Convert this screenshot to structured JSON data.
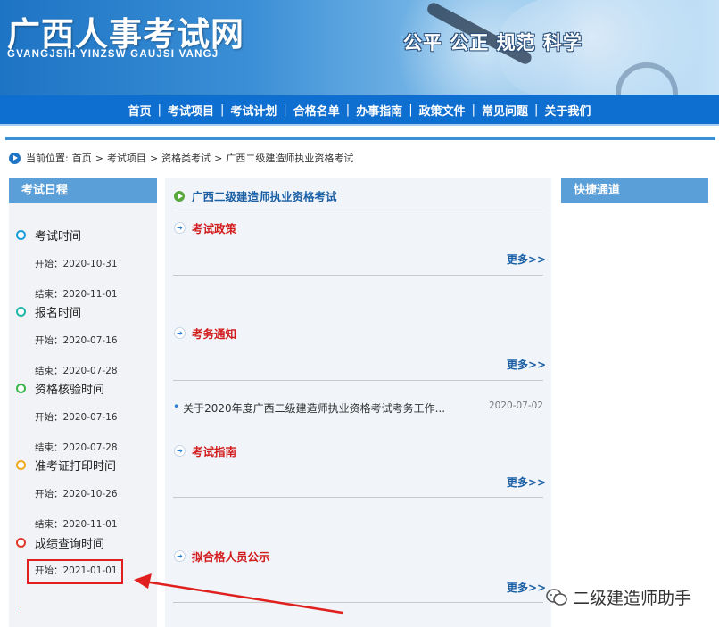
{
  "header": {
    "title": "广西人事考试网",
    "pinyin": "GVANGJSIH YINZSW GAUJSI VANGJ",
    "slogan": "公平 公正 规范 科学"
  },
  "nav": [
    "首页",
    "考试项目",
    "考试计划",
    "合格名单",
    "办事指南",
    "政策文件",
    "常见问题",
    "关于我们"
  ],
  "breadcrumb": {
    "label": "当前位置:",
    "items": [
      "首页",
      ">",
      "考试项目",
      ">",
      "资格类考试",
      ">",
      "广西二级建造师执业资格考试"
    ]
  },
  "left": {
    "heading": "考试日程",
    "items": [
      {
        "title": "考试时间",
        "start": "开始：2020-10-31",
        "end": "结束：2020-11-01",
        "color": "#1a9cd8"
      },
      {
        "title": "报名时间",
        "start": "开始：2020-07-16",
        "end": "结束：2020-07-28",
        "color": "#22b6a8"
      },
      {
        "title": "资格核验时间",
        "start": "开始：2020-07-16",
        "end": "结束：2020-07-28",
        "color": "#3cb54a"
      },
      {
        "title": "准考证打印时间",
        "start": "开始：2020-10-26",
        "end": "结束：2020-11-01",
        "color": "#f0a81e"
      },
      {
        "title": "成绩查询时间",
        "start": "开始：2021-01-01",
        "end": "",
        "color": "#e0392b"
      }
    ]
  },
  "main": {
    "heading": "广西二级建造师执业资格考试",
    "more_label": "更多>>",
    "sections": [
      {
        "title": "考试政策",
        "news": []
      },
      {
        "title": "考务通知",
        "news": [
          {
            "title": "关于2020年度广西二级建造师执业资格考试考务工作...",
            "date": "2020-07-02"
          }
        ]
      },
      {
        "title": "考试指南",
        "news": []
      },
      {
        "title": "拟合格人员公示",
        "news": []
      }
    ]
  },
  "right": {
    "heading": "快捷通道"
  },
  "watermark": "二级建造师助手",
  "colors": {
    "nav": "#0e6fd0",
    "section_head": "#5b9fd8",
    "section_title": "#d21b1b",
    "link": "#1b5fa5",
    "annotation": "#e0201e"
  }
}
